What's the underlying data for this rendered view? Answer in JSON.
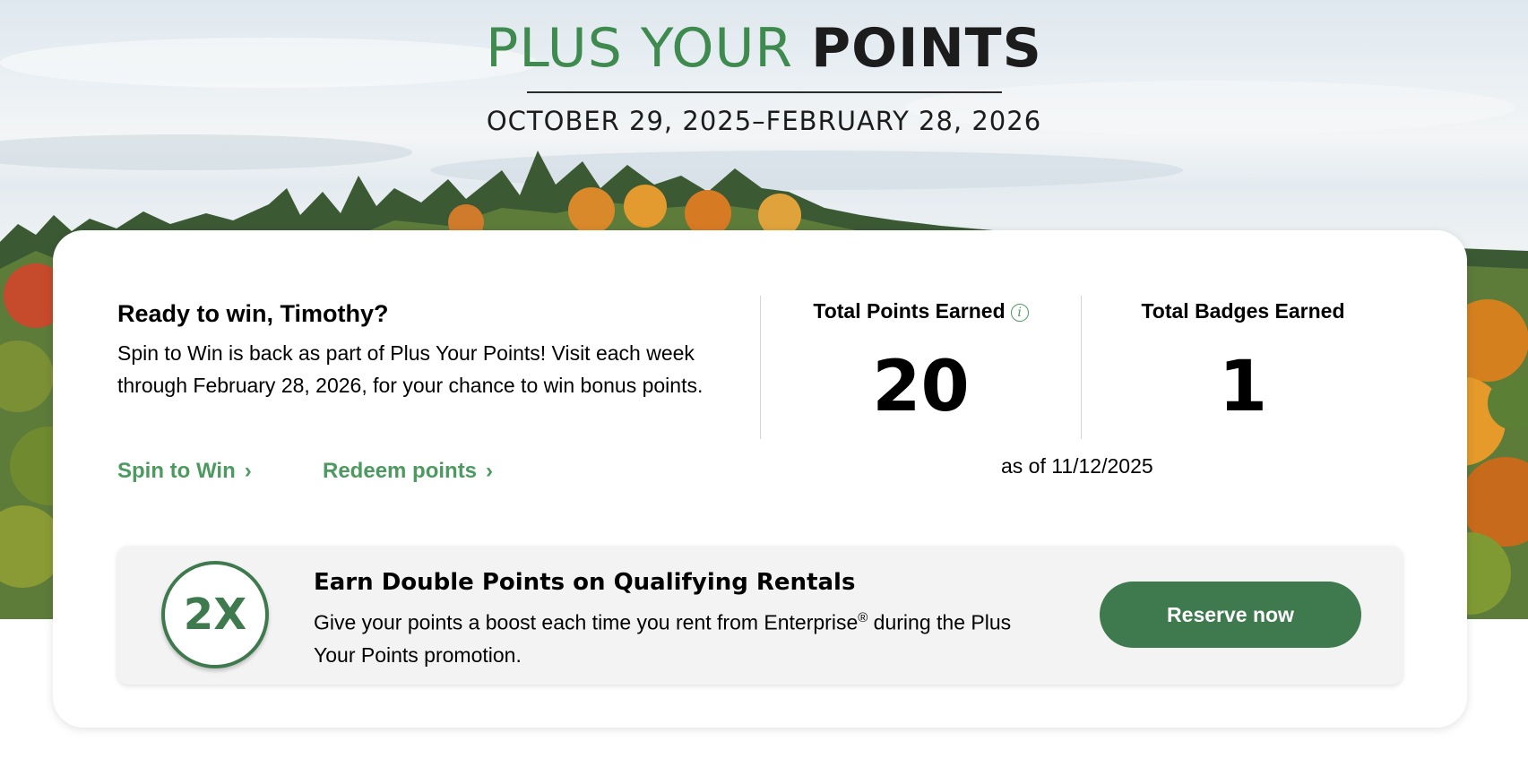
{
  "header": {
    "title_light": "PLUS YOUR ",
    "title_bold": "POINTS",
    "dates": "OCTOBER 29, 2025–FEBRUARY 28, 2026"
  },
  "intro": {
    "heading": "Ready to win, Timothy?",
    "body": "Spin to Win is back as part of Plus Your Points! Visit each week through February 28, 2026, for your chance to win bonus points.",
    "spin_link": "Spin to Win",
    "redeem_link": "Redeem points",
    "link_chevron": "›"
  },
  "stats": {
    "points_label": "Total Points Earned",
    "points_value": "20",
    "badges_label": "Total Badges Earned",
    "badges_value": "1",
    "as_of": "as of 11/12/2025",
    "info_icon_glyph": "i"
  },
  "promo": {
    "badge": "2X",
    "heading": "Earn Double Points on Qualifying Rentals",
    "body_part1": "Give your points a boost each time you rent from Enterprise",
    "registered": "®",
    "body_part2": " during the Plus Your Points promotion.",
    "button": "Reserve now"
  },
  "colors": {
    "brand_green": "#3f7a4e",
    "link_green": "#4c9a5f",
    "title_green": "#3f8a4f"
  }
}
